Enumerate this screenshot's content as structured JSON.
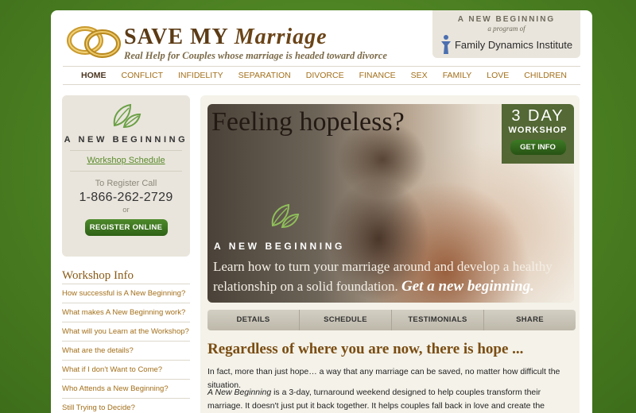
{
  "header": {
    "title_a": "SAVE MY ",
    "title_b": "Marriage",
    "tagline": "Real Help for Couples whose marriage is headed toward divorce",
    "partner_line1": "A NEW BEGINNING",
    "partner_line2": "a program of",
    "partner_name": "Family Dynamics Institute"
  },
  "nav": {
    "items": [
      "HOME",
      "CONFLICT",
      "INFIDELITY",
      "SEPARATION",
      "DIVORCE",
      "FINANCE",
      "SEX",
      "FAMILY",
      "LOVE",
      "CHILDREN"
    ]
  },
  "sidebar": {
    "program_name": "A NEW BEGINNING",
    "schedule_link": "Workshop Schedule",
    "register_call": "To Register Call",
    "phone": "1-866-262-2729",
    "or": "or",
    "register_button": "REGISTER ONLINE",
    "info_title": "Workshop Info",
    "info_links": [
      "How successful is A New Beginning?",
      "What makes A New Beginning work?",
      "What will you Learn at the Workshop?",
      "What are the details?",
      "What if I don't Want to Come?",
      "Who Attends a New Beginning?",
      "Still Trying to Decide?"
    ]
  },
  "hero": {
    "title": "Feeling hopeless?",
    "badge_big": "3 DAY",
    "badge_small": "WORKSHOP",
    "badge_button": "GET INFO",
    "program_name": "A NEW BEGINNING",
    "text": "Learn how to turn your marriage around and develop a healthy relationship on a solid foundation. ",
    "text_em": "Get a new beginning."
  },
  "tabs": [
    "DETAILS",
    "SCHEDULE",
    "TESTIMONIALS",
    "SHARE"
  ],
  "content": {
    "heading": "Regardless of where you are now, there is hope ...",
    "p1": "In fact, more than just hope… a way that any marriage can be saved, no matter how difficult the situation.",
    "p2_em": "A New Beginning",
    "p2": " is a 3-day, turnaround weekend designed to help couples transform their marriage. It doesn't just put it back together. It helps couples fall back in love and create the marriage they always hoped to have. It restarts the relationship and gives it a new beginning!"
  }
}
